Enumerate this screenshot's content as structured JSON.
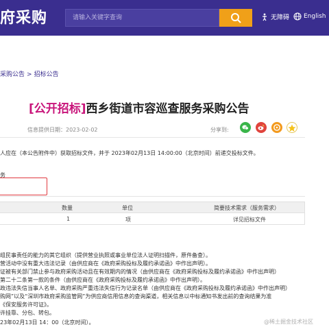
{
  "header": {
    "logo": "府采购",
    "search_placeholder": "请输入关键字查询",
    "accessibility": "无障碍",
    "english": "English"
  },
  "breadcrumb": [
    "采购公告",
    "招标公告"
  ],
  "notice": {
    "tag": "[公开招标]",
    "title": "西乡街道市容巡查服务采购公告",
    "provider_label": "信息提供日期：",
    "date": "2023-02-02",
    "share_label": "分享到:",
    "intro": "人应在（本公告附件中）获取招标文件，并于 2023年02月13日 14:00:00（北京时间）前递交投标文件。",
    "section_label": "务"
  },
  "table": {
    "headers": [
      "数量",
      "单位",
      "简要技术需求（服务需求）"
    ],
    "rows": [
      [
        "1",
        "项",
        "详见招标文件"
      ]
    ]
  },
  "body_lines": [
    "组民事责任的能力的其它组织（提供营业执照或事业单位法人证明扫描件，原件备查）。",
    "营活动中没有重大违法记录（由供应商在《政府采购投标及履约承诺函》中作出声明）。",
    "证被有关部门禁止参与政府采购活动且在有效期内的情况（由供应商在《政府采购投标及履约承诺函》中作出声明）",
    "第二十二条第一款的条件（由供应商在《政府采购投标及履约承诺函》中作出声明）。",
    "政违法失信当事人名单、政府采购严重违法失信行为记录名单（由供应商在《政府采购投标及履约承诺函》中作出声明）",
    "购网”以及“深圳市政府采购监管网”为供应商信用信息的查询渠道，相关信息以中标通知书发出前的查询结果为准",
    "《保安服务许可证》。",
    "许挂靠、分包、转包。",
    "23年02月13日 14：00（北京时间）。"
  ],
  "watermark": "@稀土掘金技术社区",
  "colors": {
    "header_bg": "#3a2e8f",
    "search_button": "#f0a019",
    "tag": "#c8147a",
    "highlight_box": "#e0383e"
  }
}
